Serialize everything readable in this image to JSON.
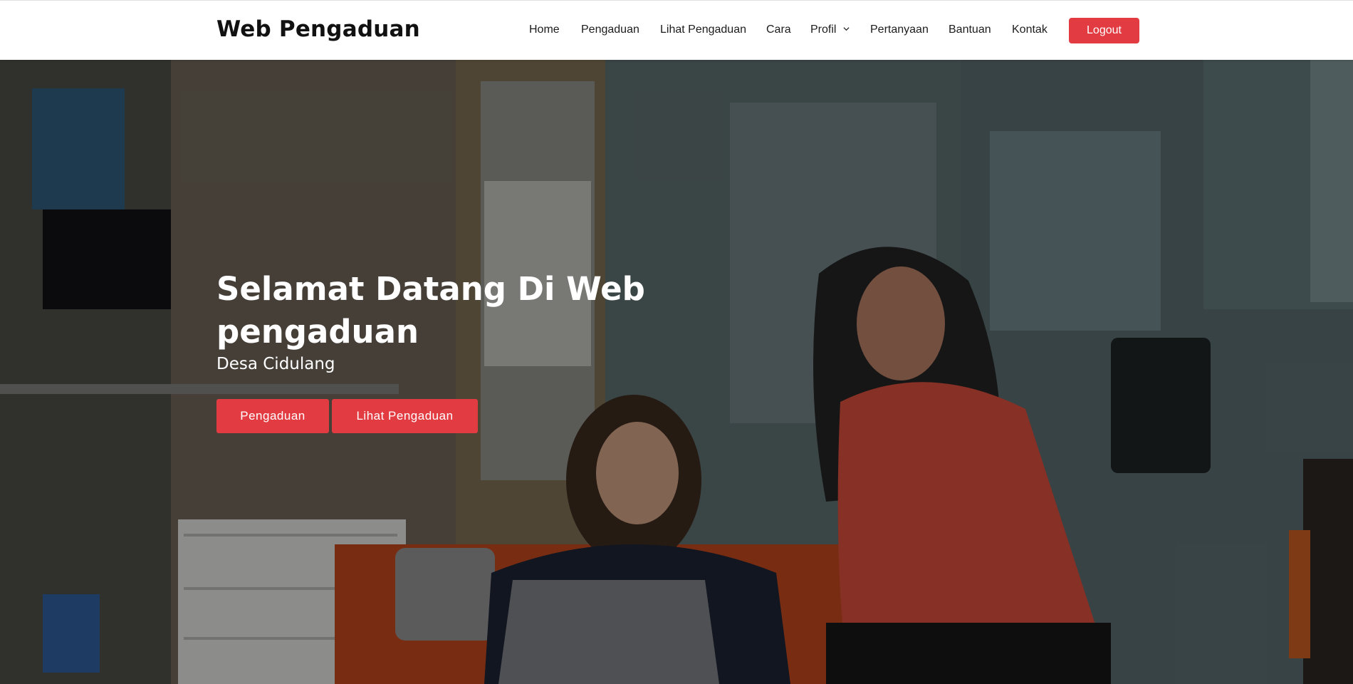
{
  "header": {
    "logo": "Web Pengaduan",
    "nav": [
      {
        "label": "Home"
      },
      {
        "label": "Pengaduan"
      },
      {
        "label": "Lihat Pengaduan"
      },
      {
        "label": "Cara"
      },
      {
        "label": "Profil",
        "icon": "chevron-down-icon"
      },
      {
        "label": "Pertanyaan"
      },
      {
        "label": "Bantuan"
      },
      {
        "label": "Kontak"
      }
    ],
    "logout_label": "Logout"
  },
  "hero": {
    "title": "Selamat Datang Di Web pengaduan",
    "subtitle": "Desa Cidulang",
    "primary_button": "Pengaduan",
    "secondary_button": "Lihat Pengaduan"
  },
  "colors": {
    "accent": "#e23c42",
    "text_dark": "#111111",
    "header_bg": "#ffffff"
  }
}
